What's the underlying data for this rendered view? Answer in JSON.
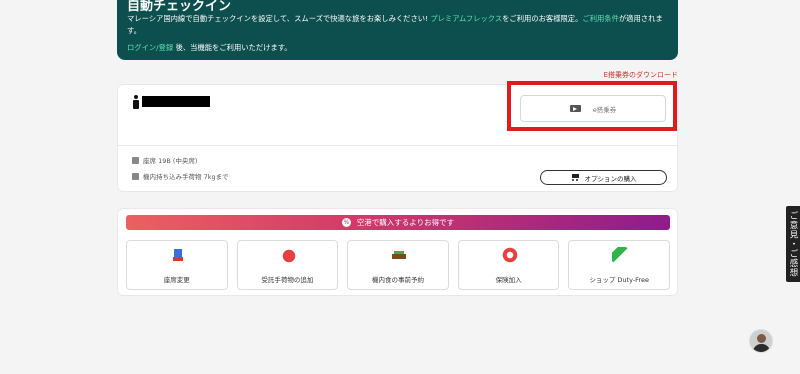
{
  "banner": {
    "title": "自動チェックイン",
    "desc_1": "マレーシア国内線で自動チェックインを設定して、スムーズで快適な旅をお楽しみください! ",
    "premium_flex": "プレミアムフレックス",
    "desc_2": "をご利用のお客様限定。",
    "terms_link": "ご利用条件",
    "desc_3": "が適用されます。",
    "login_link": "ログイン/登録",
    "login_suffix": " 後、当機能をご利用いただけます。"
  },
  "download_link": "E搭乗券のダウンロード",
  "passenger": {
    "eticket_label": "e搭乗券",
    "seat": "座席 19B (中央席)",
    "baggage": "機内持ち込み手荷物 7kgまで",
    "option_button": "オプションの購入"
  },
  "promo": {
    "banner_text": "空港で購入するよりお得です",
    "tiles": [
      {
        "label": "座席変更",
        "icon": "seat-icon"
      },
      {
        "label": "受託手荷物の追加",
        "icon": "baggage-icon"
      },
      {
        "label": "機内食の事前予約",
        "icon": "meal-icon"
      },
      {
        "label": "保険加入",
        "icon": "insurance-icon"
      },
      {
        "label": "ショップ Duty-Free",
        "icon": "duty-free-icon"
      }
    ]
  },
  "feedback_tab": "ご意見・ご感想",
  "colors": {
    "banner_bg": "#0d4f4f",
    "accent_green": "#5fe0b0",
    "download_link": "#c0392b",
    "highlight_red": "#e01b1b"
  }
}
